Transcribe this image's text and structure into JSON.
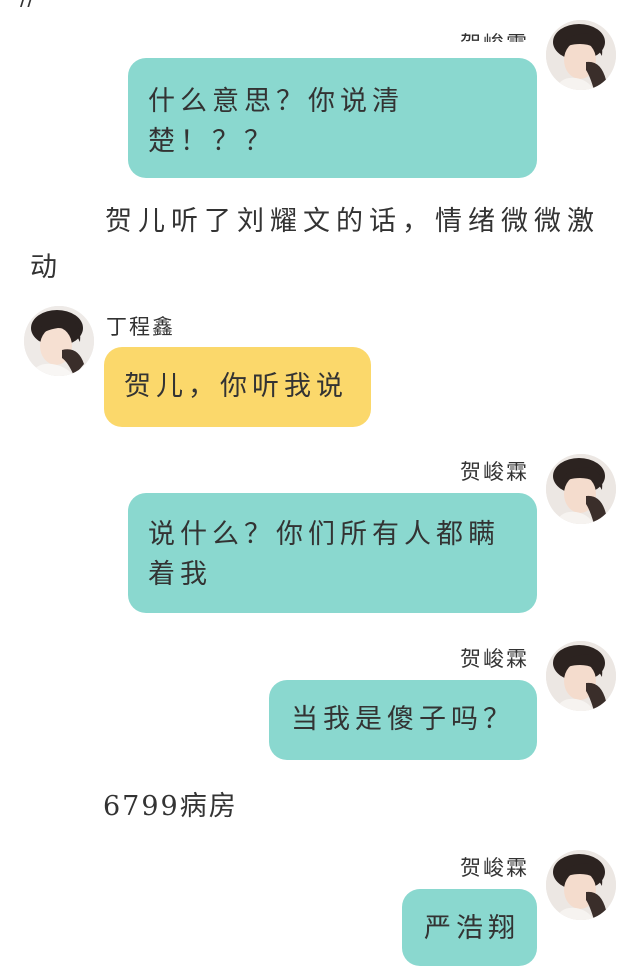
{
  "top_fragment": "//",
  "names": {
    "he": "贺峻霖",
    "ding": "丁程鑫"
  },
  "messages": [
    {
      "text": "什么意思？你说清楚！？？"
    },
    {
      "text": "贺儿，你听我说"
    },
    {
      "text": "说什么？你们所有人都瞒着我"
    },
    {
      "text": "当我是傻子吗？"
    },
    {
      "text": "严浩翔"
    }
  ],
  "narration": [
    {
      "text": "贺儿听了刘耀文的话，情绪微微激动"
    },
    {
      "text": "6799病房"
    }
  ],
  "colors": {
    "teal_bubble": "#8ad8cf",
    "yellow_bubble": "#fbd86b"
  }
}
